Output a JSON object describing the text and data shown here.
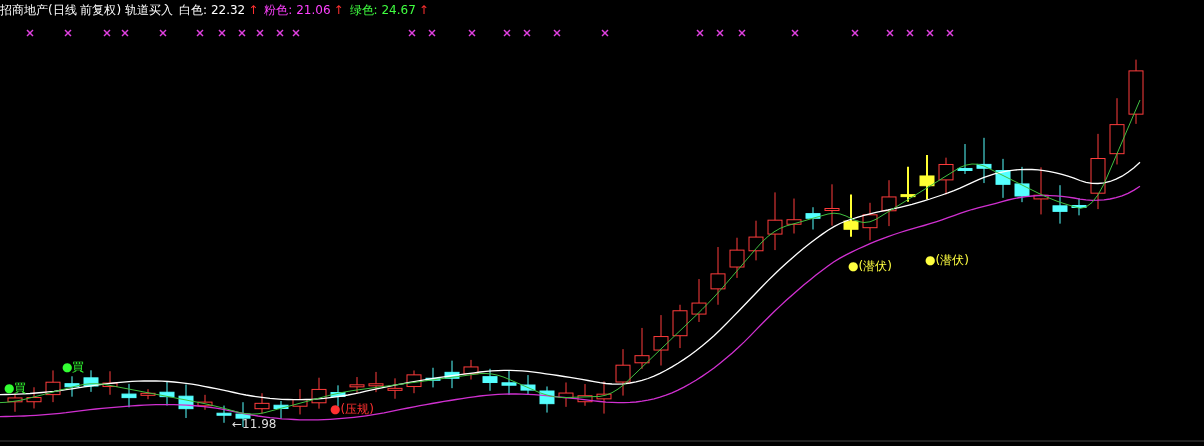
{
  "chart_header": {
    "title": "招商地产(日线 前复权) 轨道买入",
    "indicators": [
      {
        "name": "白色:",
        "value": "22.32",
        "arrow": "↑",
        "color": "#ffffff"
      },
      {
        "name": "粉色:",
        "value": "21.06",
        "arrow": "↑",
        "color": "#ff40ff"
      },
      {
        "name": "绿色:",
        "value": "24.67",
        "arrow": "↑",
        "color": "#40ff40"
      }
    ]
  },
  "annotations": [
    {
      "text": "●買",
      "kind": "buy"
    },
    {
      "text": "●買",
      "kind": "buy"
    },
    {
      "text": "←11.98",
      "kind": "low"
    },
    {
      "text": "●(压规)",
      "kind": "pressure"
    },
    {
      "text": "●(潜伏)",
      "kind": "lurk"
    },
    {
      "text": "●(潜伏)",
      "kind": "lurk"
    }
  ]
}
